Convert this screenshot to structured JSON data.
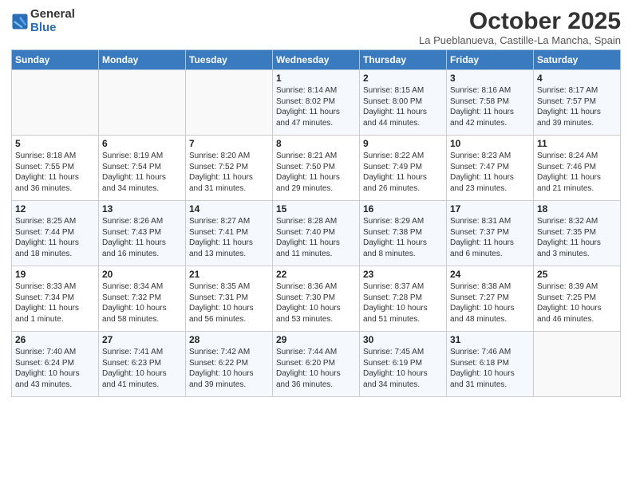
{
  "header": {
    "logo_general": "General",
    "logo_blue": "Blue",
    "month": "October 2025",
    "location": "La Pueblanueva, Castille-La Mancha, Spain"
  },
  "days_of_week": [
    "Sunday",
    "Monday",
    "Tuesday",
    "Wednesday",
    "Thursday",
    "Friday",
    "Saturday"
  ],
  "weeks": [
    [
      {
        "day": "",
        "content": ""
      },
      {
        "day": "",
        "content": ""
      },
      {
        "day": "",
        "content": ""
      },
      {
        "day": "1",
        "content": "Sunrise: 8:14 AM\nSunset: 8:02 PM\nDaylight: 11 hours\nand 47 minutes."
      },
      {
        "day": "2",
        "content": "Sunrise: 8:15 AM\nSunset: 8:00 PM\nDaylight: 11 hours\nand 44 minutes."
      },
      {
        "day": "3",
        "content": "Sunrise: 8:16 AM\nSunset: 7:58 PM\nDaylight: 11 hours\nand 42 minutes."
      },
      {
        "day": "4",
        "content": "Sunrise: 8:17 AM\nSunset: 7:57 PM\nDaylight: 11 hours\nand 39 minutes."
      }
    ],
    [
      {
        "day": "5",
        "content": "Sunrise: 8:18 AM\nSunset: 7:55 PM\nDaylight: 11 hours\nand 36 minutes."
      },
      {
        "day": "6",
        "content": "Sunrise: 8:19 AM\nSunset: 7:54 PM\nDaylight: 11 hours\nand 34 minutes."
      },
      {
        "day": "7",
        "content": "Sunrise: 8:20 AM\nSunset: 7:52 PM\nDaylight: 11 hours\nand 31 minutes."
      },
      {
        "day": "8",
        "content": "Sunrise: 8:21 AM\nSunset: 7:50 PM\nDaylight: 11 hours\nand 29 minutes."
      },
      {
        "day": "9",
        "content": "Sunrise: 8:22 AM\nSunset: 7:49 PM\nDaylight: 11 hours\nand 26 minutes."
      },
      {
        "day": "10",
        "content": "Sunrise: 8:23 AM\nSunset: 7:47 PM\nDaylight: 11 hours\nand 23 minutes."
      },
      {
        "day": "11",
        "content": "Sunrise: 8:24 AM\nSunset: 7:46 PM\nDaylight: 11 hours\nand 21 minutes."
      }
    ],
    [
      {
        "day": "12",
        "content": "Sunrise: 8:25 AM\nSunset: 7:44 PM\nDaylight: 11 hours\nand 18 minutes."
      },
      {
        "day": "13",
        "content": "Sunrise: 8:26 AM\nSunset: 7:43 PM\nDaylight: 11 hours\nand 16 minutes."
      },
      {
        "day": "14",
        "content": "Sunrise: 8:27 AM\nSunset: 7:41 PM\nDaylight: 11 hours\nand 13 minutes."
      },
      {
        "day": "15",
        "content": "Sunrise: 8:28 AM\nSunset: 7:40 PM\nDaylight: 11 hours\nand 11 minutes."
      },
      {
        "day": "16",
        "content": "Sunrise: 8:29 AM\nSunset: 7:38 PM\nDaylight: 11 hours\nand 8 minutes."
      },
      {
        "day": "17",
        "content": "Sunrise: 8:31 AM\nSunset: 7:37 PM\nDaylight: 11 hours\nand 6 minutes."
      },
      {
        "day": "18",
        "content": "Sunrise: 8:32 AM\nSunset: 7:35 PM\nDaylight: 11 hours\nand 3 minutes."
      }
    ],
    [
      {
        "day": "19",
        "content": "Sunrise: 8:33 AM\nSunset: 7:34 PM\nDaylight: 11 hours\nand 1 minute."
      },
      {
        "day": "20",
        "content": "Sunrise: 8:34 AM\nSunset: 7:32 PM\nDaylight: 10 hours\nand 58 minutes."
      },
      {
        "day": "21",
        "content": "Sunrise: 8:35 AM\nSunset: 7:31 PM\nDaylight: 10 hours\nand 56 minutes."
      },
      {
        "day": "22",
        "content": "Sunrise: 8:36 AM\nSunset: 7:30 PM\nDaylight: 10 hours\nand 53 minutes."
      },
      {
        "day": "23",
        "content": "Sunrise: 8:37 AM\nSunset: 7:28 PM\nDaylight: 10 hours\nand 51 minutes."
      },
      {
        "day": "24",
        "content": "Sunrise: 8:38 AM\nSunset: 7:27 PM\nDaylight: 10 hours\nand 48 minutes."
      },
      {
        "day": "25",
        "content": "Sunrise: 8:39 AM\nSunset: 7:25 PM\nDaylight: 10 hours\nand 46 minutes."
      }
    ],
    [
      {
        "day": "26",
        "content": "Sunrise: 7:40 AM\nSunset: 6:24 PM\nDaylight: 10 hours\nand 43 minutes."
      },
      {
        "day": "27",
        "content": "Sunrise: 7:41 AM\nSunset: 6:23 PM\nDaylight: 10 hours\nand 41 minutes."
      },
      {
        "day": "28",
        "content": "Sunrise: 7:42 AM\nSunset: 6:22 PM\nDaylight: 10 hours\nand 39 minutes."
      },
      {
        "day": "29",
        "content": "Sunrise: 7:44 AM\nSunset: 6:20 PM\nDaylight: 10 hours\nand 36 minutes."
      },
      {
        "day": "30",
        "content": "Sunrise: 7:45 AM\nSunset: 6:19 PM\nDaylight: 10 hours\nand 34 minutes."
      },
      {
        "day": "31",
        "content": "Sunrise: 7:46 AM\nSunset: 6:18 PM\nDaylight: 10 hours\nand 31 minutes."
      },
      {
        "day": "",
        "content": ""
      }
    ]
  ]
}
